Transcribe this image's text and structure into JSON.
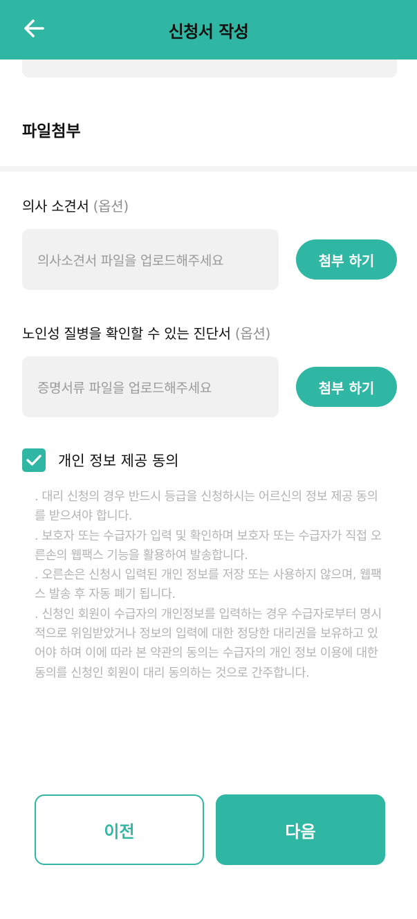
{
  "header": {
    "title": "신청서 작성",
    "back_icon": "arrow-left-icon"
  },
  "section": {
    "title": "파일첨부"
  },
  "doctor_opinion": {
    "label": "의사 소견서",
    "optional": "(옵션)",
    "placeholder": "의사소견서 파일을 업로드해주세요",
    "button": "첨부 하기"
  },
  "diagnosis": {
    "label": "노인성 질병을 확인할 수 있는 진단서",
    "optional": "(옵션)",
    "placeholder": "증명서류 파일을 업로드해주세요",
    "button": "첨부 하기"
  },
  "consent": {
    "checked": true,
    "label": "개인 정보 제공 동의",
    "terms": [
      ". 대리 신청의 경우 반드시 등급을 신청하시는 어르신의 정보 제공 동의를 받으셔야 합니다.",
      ". 보호자 또는 수급자가 입력 및 확인하며 보호자 또는 수급자가 직접 오른손의 웹팩스 기능을 활용하여 발송합니다.",
      ". 오른손은 신청시 입력된 개인 정보를 저장 또는 사용하지 않으며, 웹팩스 발송 후 자동 폐기 됩니다.",
      ". 신청인 회원이 수급자의 개인정보를 입력하는 경우 수급자로부터 명시적으로 위임받았거나 정보의 입력에 대한 정당한 대리권을 보유하고 있어야 하며 이에 따라 본 약관의 동의는 수급자의 개인 정보 이용에 대한 동의를 신청인 회원이 대리 동의하는 것으로 간주합니다."
    ]
  },
  "footer": {
    "prev_label": "이전",
    "next_label": "다음"
  },
  "colors": {
    "accent": "#2fb7a3",
    "input_bg": "#f1f1f1",
    "muted_text": "#b3b3b3"
  }
}
